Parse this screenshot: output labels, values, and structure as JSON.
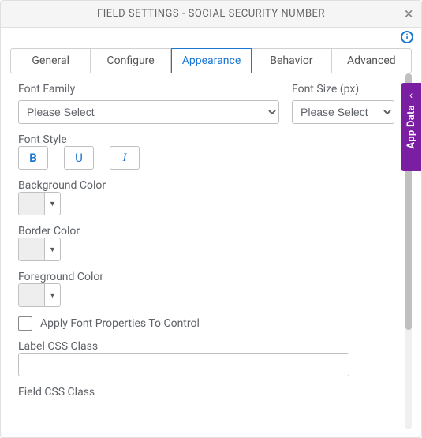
{
  "title": "FIELD SETTINGS - SOCIAL SECURITY NUMBER",
  "tabs": {
    "general": "General",
    "configure": "Configure",
    "appearance": "Appearance",
    "behavior": "Behavior",
    "advanced": "Advanced"
  },
  "labels": {
    "fontFamily": "Font Family",
    "fontSize": "Font Size (px)",
    "fontStyle": "Font Style",
    "backgroundColor": "Background Color",
    "borderColor": "Border Color",
    "foregroundColor": "Foreground Color",
    "applyFont": "Apply Font Properties To Control",
    "labelCss": "Label CSS Class",
    "fieldCss": "Field CSS Class"
  },
  "selects": {
    "fontFamilyValue": "Please Select",
    "fontSizeValue": "Please Select"
  },
  "styleButtons": {
    "bold": "B",
    "underline": "U",
    "italic": "I"
  },
  "sideTab": "App Data",
  "icons": {
    "info": "i",
    "close": "×",
    "dropdown": "▼",
    "chevronLeft": "‹"
  },
  "inputs": {
    "labelCssValue": ""
  }
}
